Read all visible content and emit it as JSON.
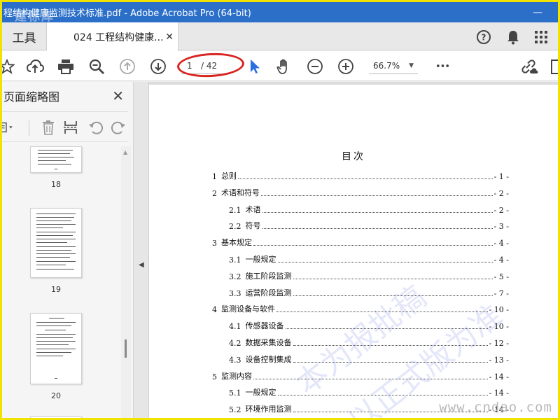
{
  "window": {
    "title": "程结构健康监测技术标准.pdf - Adobe Acrobat Pro (64-bit)",
    "logo_overlay": "建标库",
    "minimize": "—"
  },
  "tabs": {
    "tools_label": "工具",
    "doc_label": "024 工程结构健康...",
    "close_glyph": "✕"
  },
  "toolbar": {
    "current_page": "1",
    "total_pages": "/ 42",
    "zoom": "66.7%",
    "more": "•••"
  },
  "panel": {
    "title": "页面缩略图",
    "close": "✕",
    "thumbnails": [
      {
        "label": "18"
      },
      {
        "label": "19"
      },
      {
        "label": "20"
      }
    ]
  },
  "document": {
    "toc_title": "目次",
    "toc": [
      {
        "num": "1",
        "text": "总则",
        "page": "- 1 -",
        "level": 1
      },
      {
        "num": "2",
        "text": "术语和符号",
        "page": "- 2 -",
        "level": 1
      },
      {
        "num": "2.1",
        "text": "术语",
        "page": "- 2 -",
        "level": 2
      },
      {
        "num": "2.2",
        "text": "符号",
        "page": "- 3 -",
        "level": 2
      },
      {
        "num": "3",
        "text": "基本规定",
        "page": "- 4 -",
        "level": 1
      },
      {
        "num": "3.1",
        "text": "一般规定",
        "page": "- 4 -",
        "level": 2
      },
      {
        "num": "3.2",
        "text": "施工阶段监测",
        "page": "- 5 -",
        "level": 2
      },
      {
        "num": "3.3",
        "text": "运营阶段监测",
        "page": "- 7 -",
        "level": 2
      },
      {
        "num": "4",
        "text": "监测设备与软件",
        "page": "- 10 -",
        "level": 1
      },
      {
        "num": "4.1",
        "text": "传感器设备",
        "page": "- 10 -",
        "level": 2
      },
      {
        "num": "4.2",
        "text": "数据采集设备",
        "page": "- 12 -",
        "level": 2
      },
      {
        "num": "4.3",
        "text": "设备控制集成",
        "page": "- 13 -",
        "level": 2
      },
      {
        "num": "5",
        "text": "监测内容",
        "page": "- 14 -",
        "level": 1
      },
      {
        "num": "5.1",
        "text": "一般规定",
        "page": "- 14 -",
        "level": 2
      },
      {
        "num": "5.2",
        "text": "环境作用监测",
        "page": "- 14 -",
        "level": 2
      }
    ],
    "watermark_1": "本为报批稿",
    "watermark_2": "以正式版为准",
    "site_mark": "www.cndao.com"
  },
  "colors": {
    "titlebar": "#2b6fc9",
    "frame": "#f2e200",
    "annotation": "#d8241f",
    "cursor_blue": "#2a6ee0"
  }
}
